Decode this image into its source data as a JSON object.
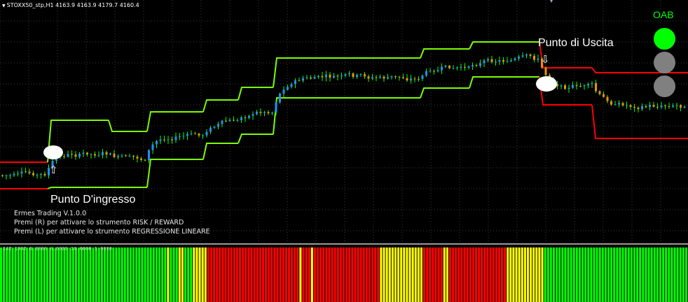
{
  "header": {
    "symbol_info": "STOXX50_stp,H1  4163.9 4163.9 4179.7 4160.4",
    "oab_label": "OAB"
  },
  "annotations": {
    "entry_label": "Punto D'ingresso",
    "exit_label": "Punto di Uscita",
    "entry_arrow": "⇧",
    "exit_arrow": "⇩"
  },
  "info": {
    "line1": "Ermes Trading  V.1.0.0",
    "line2": "Premi (R) per attivare lo strumento RISK / REWARD",
    "line3": "Premi (L) per attivare lo strumento REGRESSIONE LINEARE"
  },
  "subpanel": {
    "info": "142.1932 0.0000 0.0000 10.0000 1.0000"
  },
  "lamps": [
    "green",
    "gray",
    "gray"
  ],
  "colors": {
    "background": "#000000",
    "grid": "#3a3a3a",
    "channel": "#7cfc00",
    "channel_exit": "#ff0000",
    "candle_up": "#1e90ff",
    "candle_down": "#ff8c00",
    "lamp_on": "#00ff00",
    "lamp_off": "#808080",
    "bar_green": "#00ff00",
    "bar_yellow": "#ffff00",
    "bar_red": "#ff0000"
  },
  "chart_data": {
    "type": "line",
    "price_steps": [
      {
        "start": 0,
        "end": 68,
        "upper": 232,
        "lower": 270,
        "color": "red"
      },
      {
        "start": 68,
        "end": 155,
        "upper": 172,
        "lower": 268,
        "color": "green"
      },
      {
        "start": 155,
        "end": 210,
        "upper": 188,
        "lower": 268,
        "color": "green"
      },
      {
        "start": 210,
        "end": 290,
        "upper": 160,
        "lower": 228,
        "color": "green"
      },
      {
        "start": 290,
        "end": 340,
        "upper": 143,
        "lower": 205,
        "color": "green"
      },
      {
        "start": 340,
        "end": 390,
        "upper": 125,
        "lower": 192,
        "color": "green"
      },
      {
        "start": 390,
        "end": 600,
        "upper": 83,
        "lower": 140,
        "color": "green"
      },
      {
        "start": 600,
        "end": 670,
        "upper": 70,
        "lower": 126,
        "color": "green"
      },
      {
        "start": 670,
        "end": 770,
        "upper": 60,
        "lower": 110,
        "color": "green"
      },
      {
        "start": 770,
        "end": 845,
        "upper": 97,
        "lower": 150,
        "color": "red"
      },
      {
        "start": 845,
        "end": 982,
        "upper": 104,
        "lower": 198,
        "color": "red"
      }
    ],
    "bar_colors": "GGGGGGGGGGGGGGGGGGGGGGGGGGGGGGGGGGGGGGGGGGGGGGGGGGGGGGGGGGYGGGYYGGGYYYYYRRRRRRRRRRRRRRRRRRRRRRRRRRRRRRRRYRRRYRRRRRRRRRRRRRRRRRRRRRRRYYYYYYYYYYYYYYYRRRRRRRYYRRRRRRRRRRRRRRRRRRRRYYYYYYYYYYYYYGGGGGGGGGGGGGGGGGGGGGGGGGGGGGGGGGGGGGGGGGGGGGGGGGG"
  }
}
